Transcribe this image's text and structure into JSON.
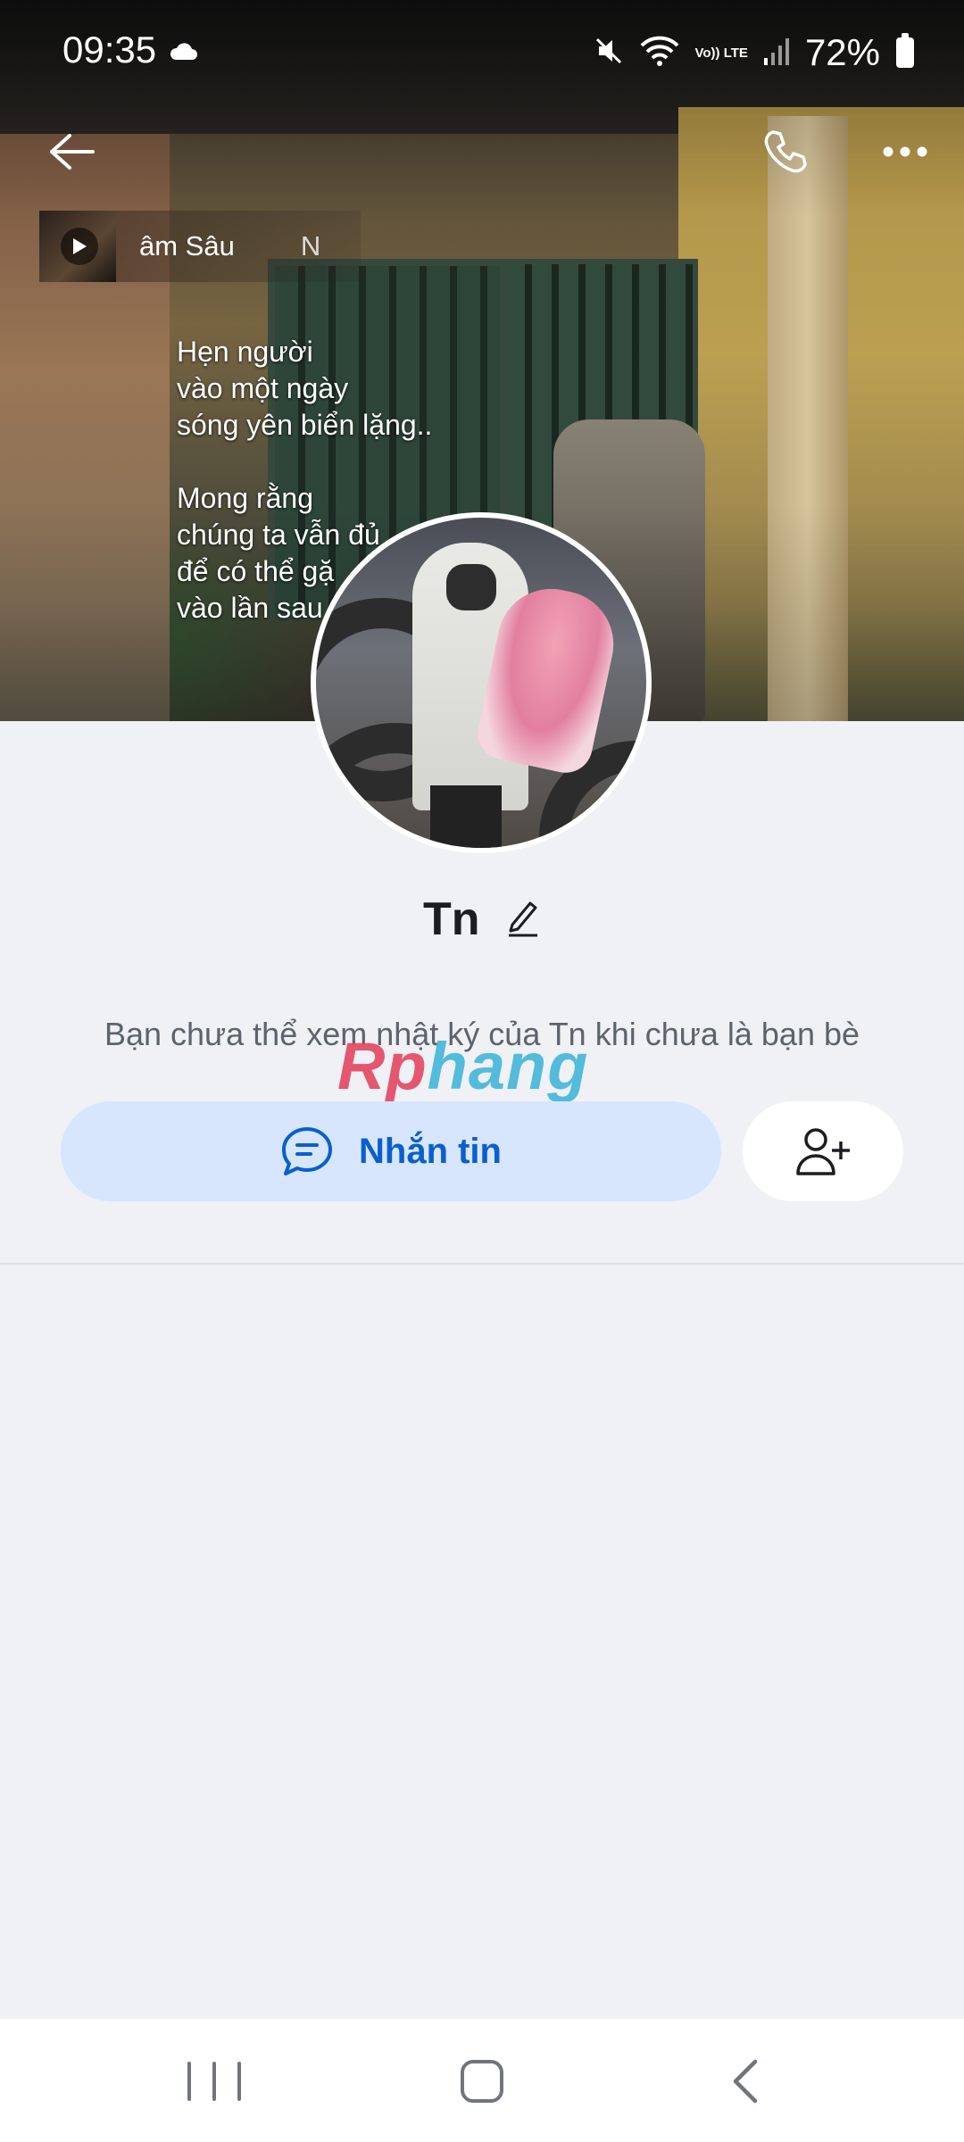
{
  "status_bar": {
    "time": "09:35",
    "battery_percent": "72%",
    "volte_label": "Vo)) LTE",
    "icons": [
      "cloud-icon",
      "mute-icon",
      "wifi-icon",
      "signal-icon",
      "battery-icon"
    ]
  },
  "header": {
    "icons": [
      "back-arrow-icon",
      "phone-call-icon",
      "more-options-icon"
    ]
  },
  "music": {
    "song_title": "âm Sâu",
    "song_title_tail": "N",
    "icon": "play-icon"
  },
  "cover_text": "Hẹn người\nvào một ngày\nsóng yên biển lặng..\n\nMong rằng\nchúng ta vẫn đủ\nđể có thể gặ\nvào lần sau",
  "profile": {
    "name": "Tn",
    "privacy_note": "Bạn chưa thể xem nhật ký của Tn khi chưa là bạn bè"
  },
  "watermark": {
    "part1": "Rp",
    "part2": "hang"
  },
  "actions": {
    "message_label": "Nhắn tin",
    "message_icon": "chat-bubble-icon",
    "add_friend_icon": "add-friend-icon"
  },
  "colors": {
    "background": "#eff1f5",
    "message_button_bg": "#d7e6fd",
    "message_button_text": "#0a5fcf"
  },
  "nav": {
    "icons": [
      "recent-apps-icon",
      "home-icon",
      "back-icon"
    ]
  }
}
